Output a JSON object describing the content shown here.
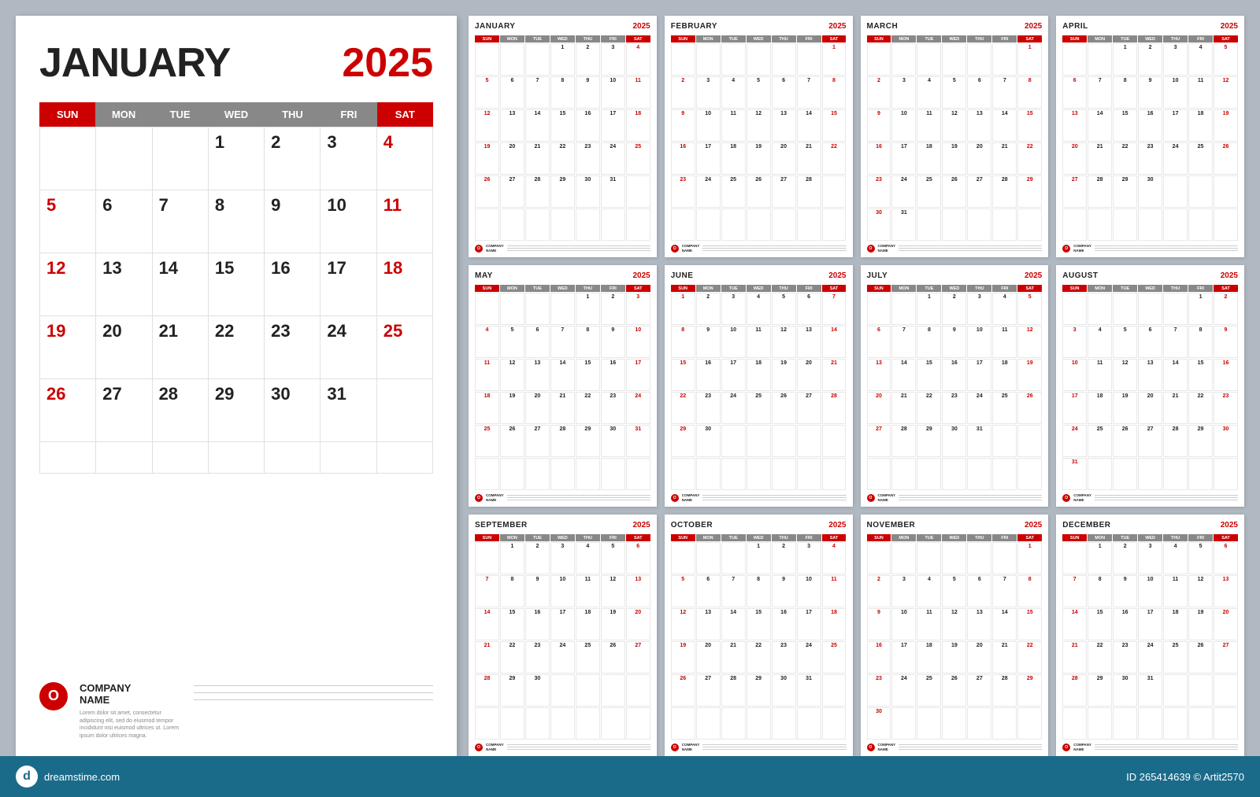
{
  "background": "#b0b8c1",
  "large_calendar": {
    "month": "JANUARY",
    "year": "2025",
    "day_headers": [
      "SUN",
      "MON",
      "TUE",
      "WED",
      "THU",
      "FRI",
      "SAT"
    ],
    "days": [
      {
        "d": "",
        "type": "empty"
      },
      {
        "d": "",
        "type": "empty"
      },
      {
        "d": "",
        "type": "empty"
      },
      {
        "d": "1",
        "type": ""
      },
      {
        "d": "2",
        "type": ""
      },
      {
        "d": "3",
        "type": ""
      },
      {
        "d": "4",
        "type": "sat"
      },
      {
        "d": "5",
        "type": "sun"
      },
      {
        "d": "6",
        "type": ""
      },
      {
        "d": "7",
        "type": ""
      },
      {
        "d": "8",
        "type": ""
      },
      {
        "d": "9",
        "type": ""
      },
      {
        "d": "10",
        "type": ""
      },
      {
        "d": "11",
        "type": "sat"
      },
      {
        "d": "12",
        "type": "sun"
      },
      {
        "d": "13",
        "type": ""
      },
      {
        "d": "14",
        "type": ""
      },
      {
        "d": "15",
        "type": ""
      },
      {
        "d": "16",
        "type": ""
      },
      {
        "d": "17",
        "type": ""
      },
      {
        "d": "18",
        "type": "sat"
      },
      {
        "d": "19",
        "type": "sun"
      },
      {
        "d": "20",
        "type": ""
      },
      {
        "d": "21",
        "type": ""
      },
      {
        "d": "22",
        "type": ""
      },
      {
        "d": "23",
        "type": ""
      },
      {
        "d": "24",
        "type": ""
      },
      {
        "d": "25",
        "type": "sat"
      },
      {
        "d": "26",
        "type": "sun"
      },
      {
        "d": "27",
        "type": ""
      },
      {
        "d": "28",
        "type": ""
      },
      {
        "d": "29",
        "type": ""
      },
      {
        "d": "30",
        "type": ""
      },
      {
        "d": "31",
        "type": ""
      },
      {
        "d": "",
        "type": "empty"
      },
      {
        "d": "",
        "type": "empty extra"
      },
      {
        "d": "",
        "type": "empty extra"
      },
      {
        "d": "",
        "type": "empty extra"
      },
      {
        "d": "",
        "type": "empty extra"
      },
      {
        "d": "",
        "type": "empty extra"
      },
      {
        "d": "",
        "type": "empty extra"
      },
      {
        "d": "",
        "type": "empty extra"
      }
    ],
    "company": {
      "name": "COMPANY\nNAME",
      "desc": "Lorem dolor sit amet, consectetur adipiscing elit, sed do eiusmod tempor incididunt nisi euismod ultrices ut. Lorem ipsum dolor ultrices magna."
    }
  },
  "small_calendars": [
    {
      "month": "JANUARY",
      "year": "2025",
      "days": [
        "",
        "",
        "",
        "1",
        "2",
        "3",
        "4",
        "5",
        "6",
        "7",
        "8",
        "9",
        "10",
        "11",
        "12",
        "13",
        "14",
        "15",
        "16",
        "17",
        "18",
        "19",
        "20",
        "21",
        "22",
        "23",
        "24",
        "25",
        "26",
        "27",
        "28",
        "29",
        "30",
        "31",
        "",
        "",
        "",
        "",
        "",
        "",
        "",
        ""
      ]
    },
    {
      "month": "FEBRUARY",
      "year": "2025",
      "days": [
        "",
        "",
        "",
        "",
        "",
        "",
        "1",
        "2",
        "3",
        "4",
        "5",
        "6",
        "7",
        "8",
        "9",
        "10",
        "11",
        "12",
        "13",
        "14",
        "15",
        "16",
        "17",
        "18",
        "19",
        "20",
        "21",
        "22",
        "23",
        "24",
        "25",
        "26",
        "27",
        "28",
        "",
        "",
        "",
        "",
        "",
        "",
        ""
      ]
    },
    {
      "month": "MARCH",
      "year": "2025",
      "days": [
        "",
        "",
        "",
        "",
        "",
        "",
        "1",
        "2",
        "3",
        "4",
        "5",
        "6",
        "7",
        "8",
        "9",
        "10",
        "11",
        "12",
        "13",
        "14",
        "15",
        "16",
        "17",
        "18",
        "19",
        "20",
        "21",
        "22",
        "23",
        "24",
        "25",
        "26",
        "27",
        "28",
        "29",
        "30",
        "31",
        "",
        "",
        "",
        ""
      ]
    },
    {
      "month": "APRIL",
      "year": "2025",
      "days": [
        "",
        "",
        "1",
        "2",
        "3",
        "4",
        "5",
        "6",
        "7",
        "8",
        "9",
        "10",
        "11",
        "12",
        "13",
        "14",
        "15",
        "16",
        "17",
        "18",
        "19",
        "20",
        "21",
        "22",
        "23",
        "24",
        "25",
        "26",
        "27",
        "28",
        "29",
        "30",
        "",
        "",
        "",
        "",
        "",
        "",
        "",
        "",
        ""
      ]
    },
    {
      "month": "MAY",
      "year": "2025",
      "days": [
        "",
        "",
        "",
        "",
        "1",
        "2",
        "3",
        "4",
        "5",
        "6",
        "7",
        "8",
        "9",
        "10",
        "11",
        "12",
        "13",
        "14",
        "15",
        "16",
        "17",
        "18",
        "19",
        "20",
        "21",
        "22",
        "23",
        "24",
        "25",
        "26",
        "27",
        "28",
        "29",
        "30",
        "31",
        "",
        "",
        "",
        "",
        "",
        ""
      ]
    },
    {
      "month": "JUNE",
      "year": "2025",
      "days": [
        "1",
        "2",
        "3",
        "4",
        "5",
        "6",
        "7",
        "8",
        "9",
        "10",
        "11",
        "12",
        "13",
        "14",
        "15",
        "16",
        "17",
        "18",
        "19",
        "20",
        "21",
        "22",
        "23",
        "24",
        "25",
        "26",
        "27",
        "28",
        "29",
        "30",
        "",
        "",
        "",
        "",
        "",
        "",
        "",
        "",
        "",
        "",
        ""
      ]
    },
    {
      "month": "JULY",
      "year": "2025",
      "days": [
        "",
        "",
        "1",
        "2",
        "3",
        "4",
        "5",
        "6",
        "7",
        "8",
        "9",
        "10",
        "11",
        "12",
        "13",
        "14",
        "15",
        "16",
        "17",
        "18",
        "19",
        "20",
        "21",
        "22",
        "23",
        "24",
        "25",
        "26",
        "27",
        "28",
        "29",
        "30",
        "31",
        "",
        "",
        "",
        "",
        "",
        "",
        "",
        ""
      ]
    },
    {
      "month": "AUGUST",
      "year": "2025",
      "days": [
        "",
        "",
        "",
        "",
        "",
        "1",
        "2",
        "3",
        "4",
        "5",
        "6",
        "7",
        "8",
        "9",
        "10",
        "11",
        "12",
        "13",
        "14",
        "15",
        "16",
        "17",
        "18",
        "19",
        "20",
        "21",
        "22",
        "23",
        "24",
        "25",
        "26",
        "27",
        "28",
        "29",
        "30",
        "31",
        "",
        "",
        "",
        "",
        "",
        ""
      ]
    },
    {
      "month": "SEPTEMBER",
      "year": "2025",
      "days": [
        "",
        "1",
        "2",
        "3",
        "4",
        "5",
        "6",
        "7",
        "8",
        "9",
        "10",
        "11",
        "12",
        "13",
        "14",
        "15",
        "16",
        "17",
        "18",
        "19",
        "20",
        "21",
        "22",
        "23",
        "24",
        "25",
        "26",
        "27",
        "28",
        "29",
        "30",
        "",
        "",
        "",
        "",
        "",
        "",
        "",
        "",
        "",
        ""
      ]
    },
    {
      "month": "OCTOBER",
      "year": "2025",
      "days": [
        "",
        "",
        "",
        "1",
        "2",
        "3",
        "4",
        "5",
        "6",
        "7",
        "8",
        "9",
        "10",
        "11",
        "12",
        "13",
        "14",
        "15",
        "16",
        "17",
        "18",
        "19",
        "20",
        "21",
        "22",
        "23",
        "24",
        "25",
        "26",
        "27",
        "28",
        "29",
        "30",
        "31",
        "",
        "",
        "",
        "",
        "",
        "",
        ""
      ]
    },
    {
      "month": "NOVEMBER",
      "year": "2025",
      "days": [
        "",
        "",
        "",
        "",
        "",
        "",
        "1",
        "2",
        "3",
        "4",
        "5",
        "6",
        "7",
        "8",
        "9",
        "10",
        "11",
        "12",
        "13",
        "14",
        "15",
        "16",
        "17",
        "18",
        "19",
        "20",
        "21",
        "22",
        "23",
        "24",
        "25",
        "26",
        "27",
        "28",
        "29",
        "30",
        "",
        "",
        "",
        "",
        "",
        ""
      ]
    },
    {
      "month": "DECEMBER",
      "year": "2025",
      "days": [
        "",
        "1",
        "2",
        "3",
        "4",
        "5",
        "6",
        "7",
        "8",
        "9",
        "10",
        "11",
        "12",
        "13",
        "14",
        "15",
        "16",
        "17",
        "18",
        "19",
        "20",
        "21",
        "22",
        "23",
        "24",
        "25",
        "26",
        "27",
        "28",
        "29",
        "30",
        "31",
        "",
        "",
        "",
        "",
        "",
        "",
        "",
        "",
        ""
      ]
    }
  ],
  "footer": {
    "site": "dreamstime.com",
    "id": "265414639",
    "author": "Artit2570"
  }
}
